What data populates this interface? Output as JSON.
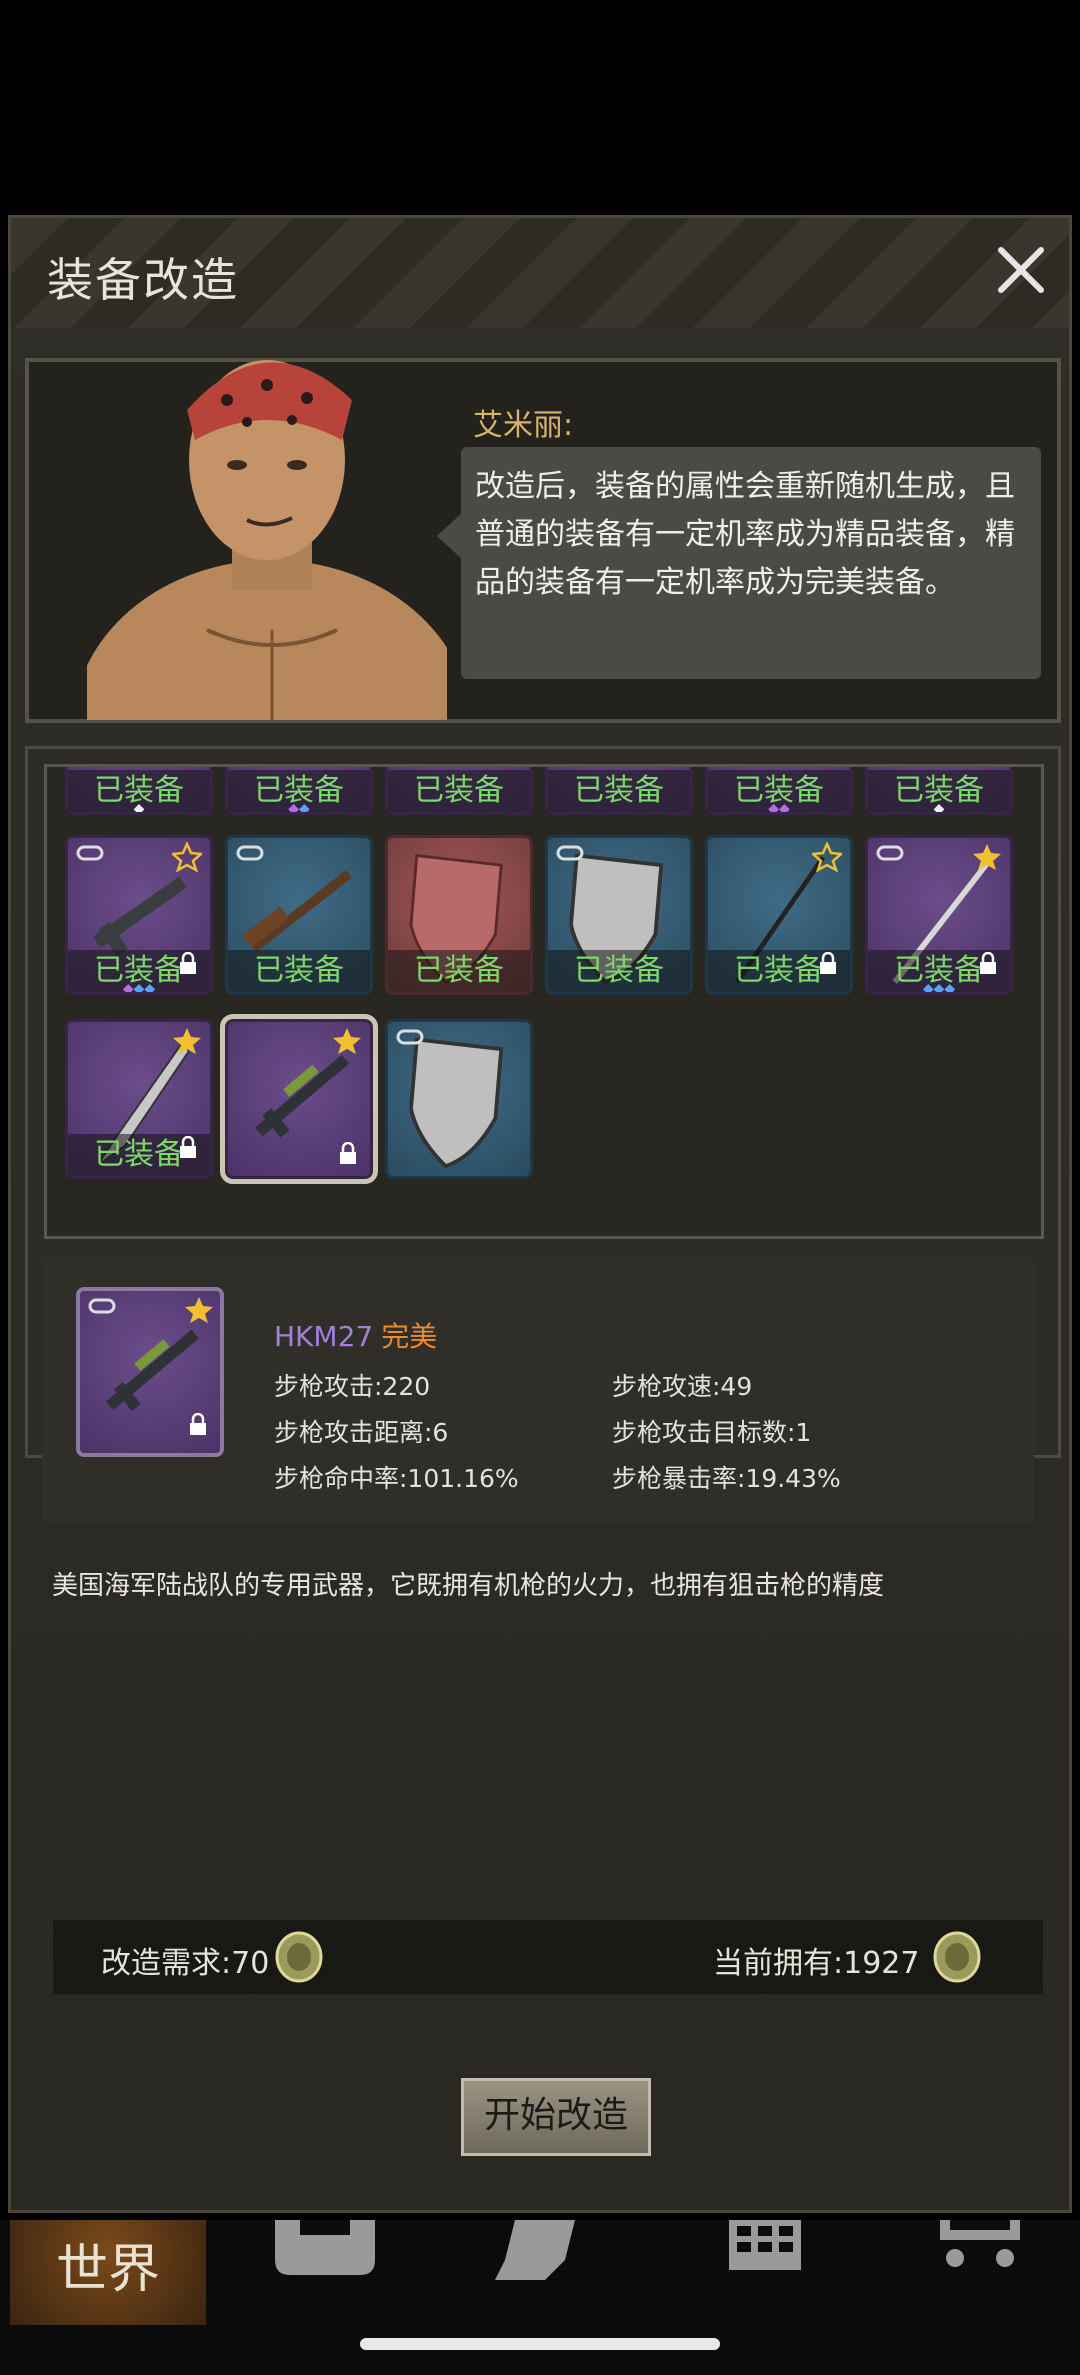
{
  "dialog": {
    "title": "装备改造",
    "close_icon": "close-icon"
  },
  "npc": {
    "name": "艾米丽:",
    "speech_lines": [
      "改造后，装备的属性会重新随机生成，且",
      "普通的装备有一定机率成为精品装备，精",
      "品的装备有一定机率成为完美装备。"
    ]
  },
  "inventory": {
    "equipped_label": "已装备",
    "items": [
      {
        "rarity": "purple",
        "equipped": "已装备"
      },
      {
        "rarity": "purple",
        "equipped": "已装备"
      },
      {
        "rarity": "purple",
        "equipped": "已装备"
      },
      {
        "rarity": "purple",
        "equipped": "已装备"
      },
      {
        "rarity": "purple",
        "equipped": "已装备"
      },
      {
        "rarity": "purple",
        "equipped": "已装备"
      },
      {
        "rarity": "purple",
        "equipped": "已装备",
        "icon": "rifle-icon"
      },
      {
        "rarity": "blue",
        "equipped": "已装备",
        "icon": "shotgun-icon"
      },
      {
        "rarity": "red",
        "equipped": "已装备",
        "icon": "shield-icon"
      },
      {
        "rarity": "blue",
        "equipped": "已装备",
        "icon": "steel-shield-icon"
      },
      {
        "rarity": "blue",
        "equipped": "已装备",
        "icon": "spear-icon"
      },
      {
        "rarity": "purple",
        "equipped": "已装备",
        "icon": "sword-icon"
      },
      {
        "rarity": "purple",
        "equipped": "已装备",
        "icon": "machete-icon"
      },
      {
        "rarity": "purple",
        "equipped": "",
        "icon": "sniper-rifle-icon",
        "selected": true
      },
      {
        "rarity": "blue",
        "equipped": "",
        "icon": "steel-shield-icon"
      }
    ]
  },
  "selected_item": {
    "name": "HKM27",
    "quality": "完美",
    "stats": {
      "attack": "步枪攻击:220",
      "speed": "步枪攻速:49",
      "range": "步枪攻击距离:6",
      "targets": "步枪攻击目标数:1",
      "accuracy": "步枪命中率:101.16%",
      "crit": "步枪暴击率:19.43%"
    },
    "description": "美国海军陆战队的专用武器，它既拥有机枪的火力，也拥有狙击枪的精度"
  },
  "cost": {
    "required": "改造需求:70",
    "owned": "当前拥有:1927",
    "currency_icon": "coin-icon"
  },
  "start_button": "开始改造",
  "nav": {
    "world": "世界"
  },
  "colors": {
    "perfect": "#ef8a2a",
    "equipped": "#7fd66a",
    "purple_name": "#a77ed6"
  }
}
